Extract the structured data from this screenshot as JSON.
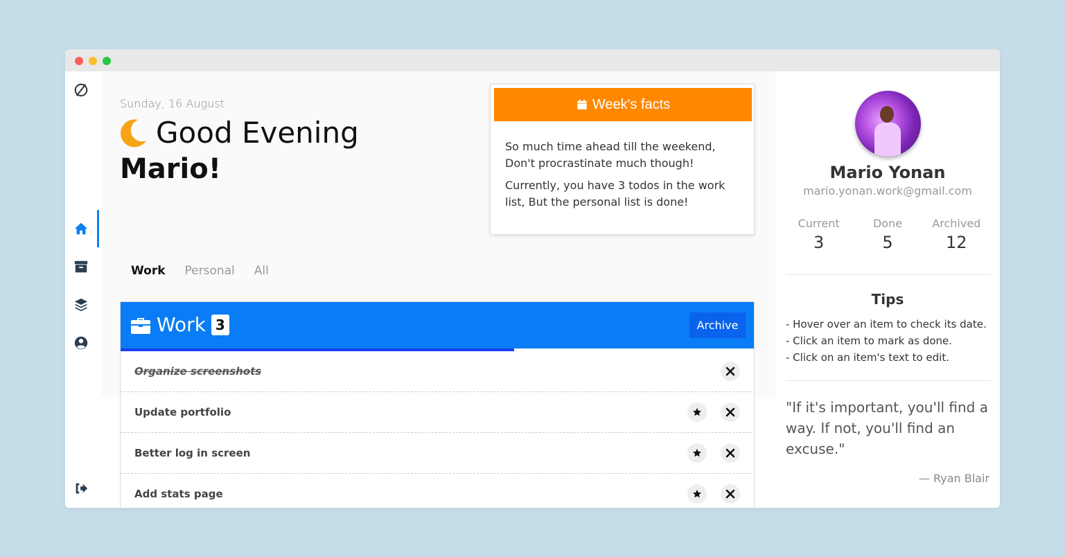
{
  "window": {
    "controls": [
      "close",
      "minimize",
      "maximize"
    ]
  },
  "sidebar": {
    "logo_icon": "no-symbol-logo-icon",
    "items": [
      {
        "icon": "home-icon",
        "active": true
      },
      {
        "icon": "archive-icon",
        "active": false
      },
      {
        "icon": "layers-icon",
        "active": false
      },
      {
        "icon": "user-circle-icon",
        "active": false
      }
    ],
    "logout_icon": "sign-out-icon"
  },
  "greeting": {
    "date": "Sunday, 16 August",
    "text": "Good Evening",
    "name": "Mario!",
    "icon": "moon-icon"
  },
  "facts": {
    "title": "Week's facts",
    "icon": "calendar-icon",
    "paragraphs": [
      "So much time ahead till the weekend, Don't procrastinate much though!",
      "Currently, you have 3 todos in the work list, But the personal list is done!"
    ],
    "accent_color": "#ff8800"
  },
  "tabs": [
    {
      "label": "Work",
      "active": true
    },
    {
      "label": "Personal",
      "active": false
    },
    {
      "label": "All",
      "active": false
    }
  ],
  "worklist": {
    "title": "Work",
    "icon": "briefcase-icon",
    "count": "3",
    "archive_label": "Archive",
    "progress_fraction": 0.62,
    "accent_color": "#0a7cf5",
    "items": [
      {
        "text": "Organize screenshots",
        "done": true
      },
      {
        "text": "Update portfolio",
        "done": false
      },
      {
        "text": "Better log in screen",
        "done": false
      },
      {
        "text": "Add stats page",
        "done": false
      }
    ]
  },
  "profile": {
    "name": "Mario Yonan",
    "email": "mario.yonan.work@gmail.com",
    "stats": [
      {
        "label": "Current",
        "value": "3"
      },
      {
        "label": "Done",
        "value": "5"
      },
      {
        "label": "Archived",
        "value": "12"
      }
    ],
    "tips_title": "Tips",
    "tips": [
      "- Hover over an item to check its date.",
      "- Click an item to mark as done.",
      "- Click on an item's text to edit."
    ],
    "quote": "\"If it's important, you'll find a way. If not, you'll find an excuse.\"",
    "quote_author": "— Ryan Blair"
  }
}
